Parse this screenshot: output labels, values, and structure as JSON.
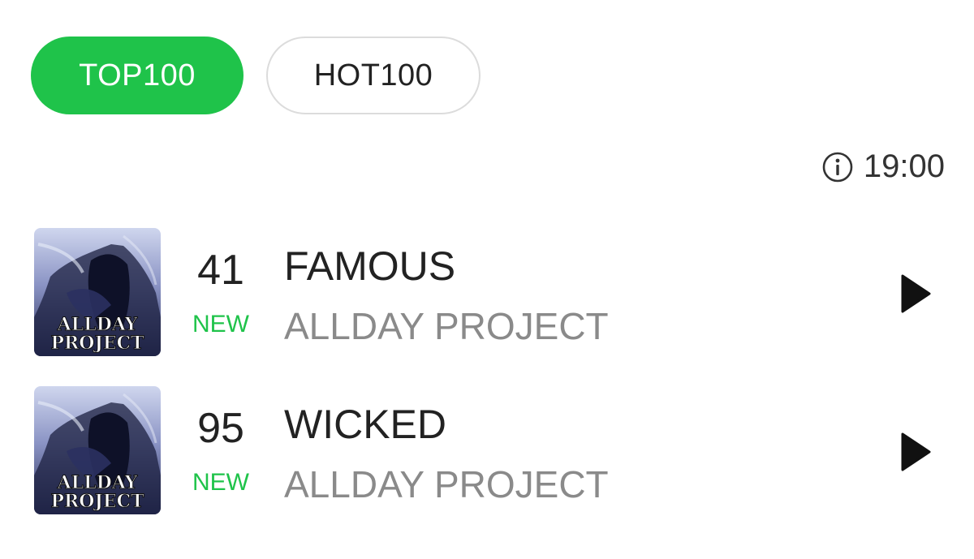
{
  "tabs": [
    {
      "label": "TOP100",
      "active": true
    },
    {
      "label": "HOT100",
      "active": false
    }
  ],
  "update": {
    "icon": "info-icon",
    "time": "19:00"
  },
  "colors": {
    "accent": "#1fc34a",
    "artist_text": "#8a8a8a",
    "primary_text": "#222222"
  },
  "chart": [
    {
      "rank": "41",
      "badge": "NEW",
      "title": "FAMOUS",
      "artist": "ALLDAY PROJECT",
      "cover_text": [
        "ALLDAY",
        "PROJECT"
      ],
      "play_icon": "play-icon"
    },
    {
      "rank": "95",
      "badge": "NEW",
      "title": "WICKED",
      "artist": "ALLDAY PROJECT",
      "cover_text": [
        "ALLDAY",
        "PROJECT"
      ],
      "play_icon": "play-icon"
    }
  ]
}
